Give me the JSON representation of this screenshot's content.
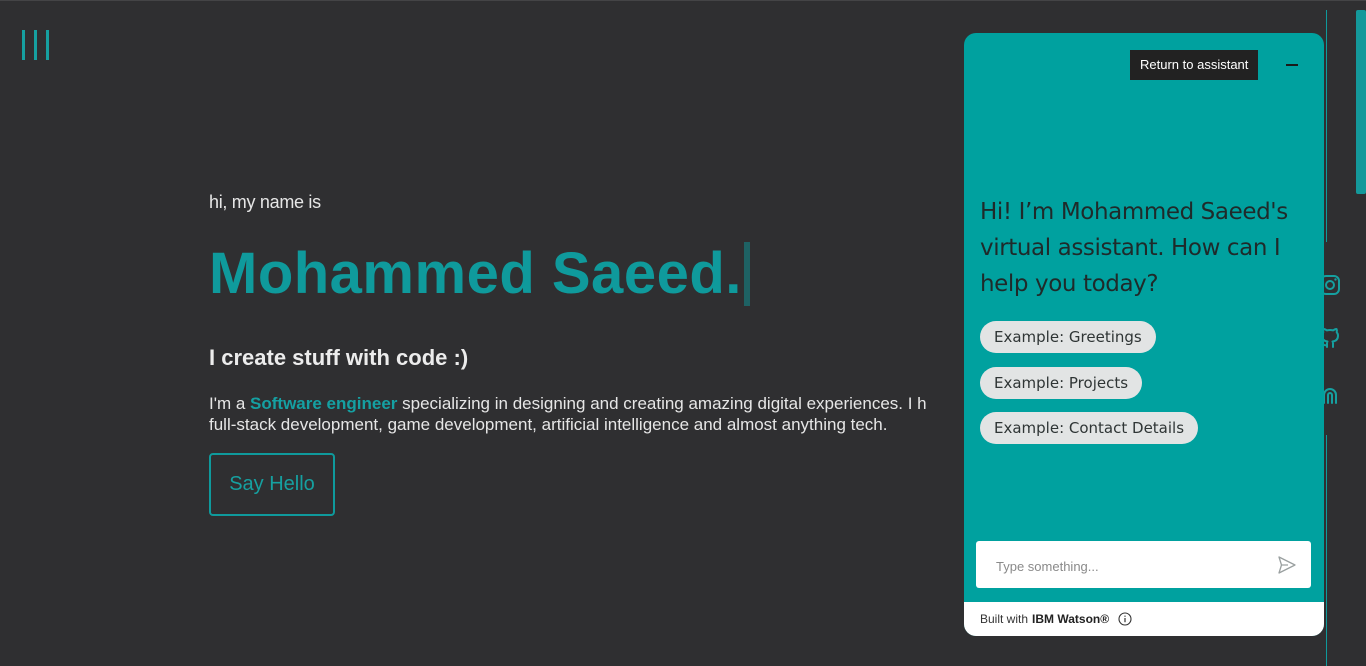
{
  "hero": {
    "intro": "hi, my name is",
    "name": "Mohammed Saeed.",
    "tagline": "I create stuff with code :)",
    "about_prefix": "I'm a ",
    "about_highlight": "Software engineer",
    "about_line1_rest": " specializing in designing and creating amazing digital experiences. I h",
    "about_line2": "full-stack development, game development, artificial intelligence and almost anything tech.",
    "cta_label": "Say Hello"
  },
  "nav": {
    "menu_icon": "hamburger-icon",
    "social_icons": [
      "instagram-icon",
      "github-icon",
      "codepen-icon"
    ]
  },
  "assistant": {
    "return_label": "Return to assistant",
    "greeting": "Hi! I’m Mohammed Saeed's virtual assistant. How can I help you today?",
    "chips": [
      "Example: Greetings",
      "Example: Projects",
      "Example: Contact Details"
    ],
    "input_placeholder": "Type something...",
    "footer_built": "Built with",
    "footer_brand": "IBM Watson®"
  },
  "colors": {
    "background": "#2f2f31",
    "accent": "#0f9a9c",
    "panel": "#00a19f"
  }
}
